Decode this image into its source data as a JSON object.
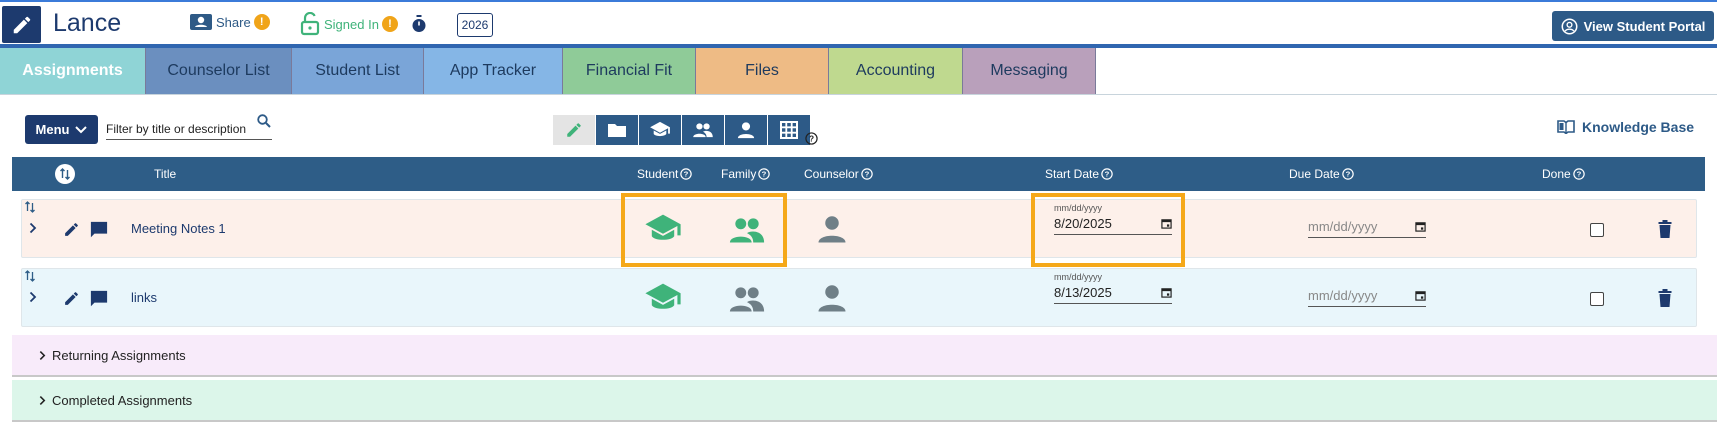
{
  "header": {
    "name": "Lance",
    "share_label": "Share",
    "share_badge": "!",
    "signed_in_label": "Signed In",
    "signed_in_badge": "!",
    "year": "2026",
    "portal_button": "View Student Portal"
  },
  "tabs": [
    {
      "label": "Assignments",
      "color": "#8fd4d6",
      "text_color": "#ffffff"
    },
    {
      "label": "Counselor List",
      "color": "#6b8fbf",
      "text_color": "#1d3a5e"
    },
    {
      "label": "Student List",
      "color": "#7aa5d8",
      "text_color": "#1d3a5e"
    },
    {
      "label": "App Tracker",
      "color": "#85b6e6",
      "text_color": "#1d3a5e"
    },
    {
      "label": "Financial Fit",
      "color": "#8fcb98",
      "text_color": "#1d3a5e"
    },
    {
      "label": "Files",
      "color": "#eebb85",
      "text_color": "#1d3a5e"
    },
    {
      "label": "Accounting",
      "color": "#bfd98f",
      "text_color": "#1d3a5e"
    },
    {
      "label": "Messaging",
      "color": "#b9a0bb",
      "text_color": "#1d3a5e"
    }
  ],
  "toolbar": {
    "menu_label": "Menu",
    "filter_placeholder": "Filter by title or description",
    "knowledge_base": "Knowledge Base"
  },
  "table": {
    "columns": {
      "title": "Title",
      "student": "Student",
      "family": "Family",
      "counselor": "Counselor",
      "start_date": "Start Date",
      "due_date": "Due Date",
      "done": "Done"
    },
    "rows": [
      {
        "title": "Meeting Notes 1",
        "start_date_label": "mm/dd/yyyy",
        "start_date": "8/20/2025",
        "due_date": "mm/dd/yyyy",
        "student_active": true,
        "family_active": true,
        "counselor_active": false,
        "done": false
      },
      {
        "title": "links",
        "start_date_label": "mm/dd/yyyy",
        "start_date": "8/13/2025",
        "due_date": "mm/dd/yyyy",
        "student_active": true,
        "family_active": false,
        "counselor_active": false,
        "done": false
      }
    ]
  },
  "sections": {
    "returning": "Returning Assignments",
    "completed": "Completed Assignments"
  },
  "colors": {
    "active_green": "#3fb37a",
    "inactive_gray": "#6f7f87",
    "highlight": "#f5a819",
    "navy": "#1d3a6e"
  }
}
